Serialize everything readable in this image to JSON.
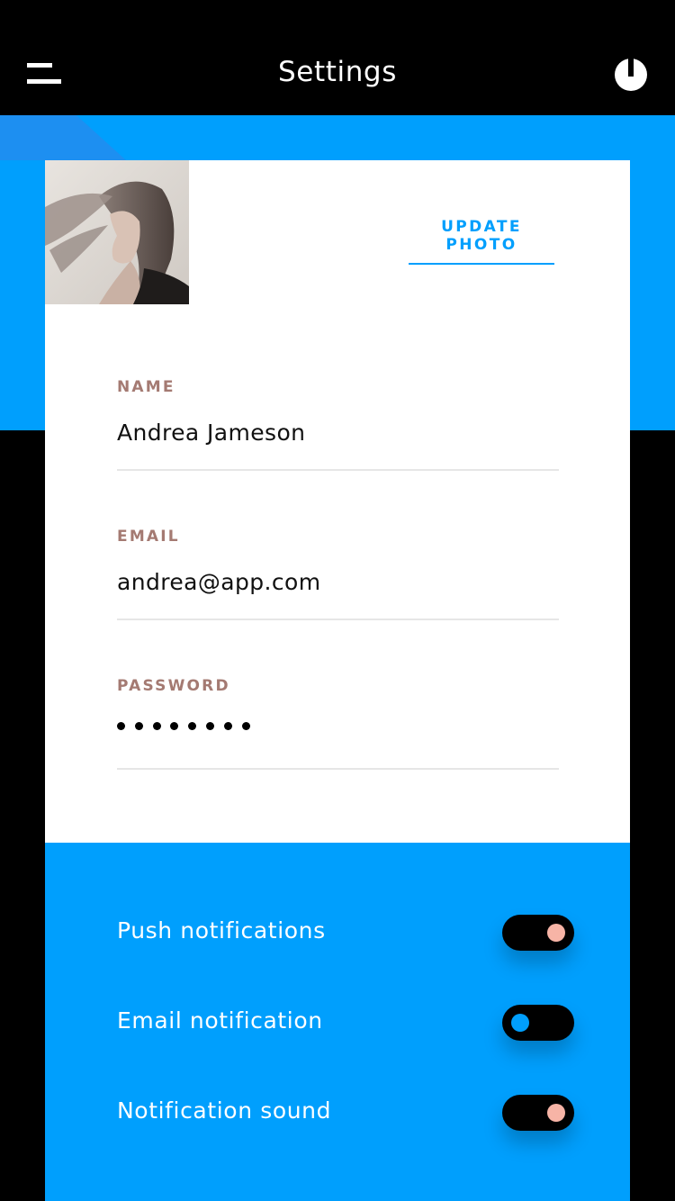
{
  "header": {
    "title": "Settings",
    "menu_icon": "menu-icon",
    "power_icon": "power-icon"
  },
  "profile": {
    "update_photo_label": "UPDATE PHOTO"
  },
  "fields": {
    "name": {
      "label": "NAME",
      "value": "Andrea Jameson"
    },
    "email": {
      "label": "EMAIL",
      "value": "andrea@app.com"
    },
    "password": {
      "label": "PASSWORD",
      "masked_length": 8
    }
  },
  "notifications": [
    {
      "label": "Push notifications",
      "enabled": true
    },
    {
      "label": "Email notification",
      "enabled": false
    },
    {
      "label": "Notification sound",
      "enabled": true
    }
  ],
  "colors": {
    "accent": "#009ffd",
    "label": "#a47a72",
    "toggle_on_knob": "#f7b4a6"
  }
}
